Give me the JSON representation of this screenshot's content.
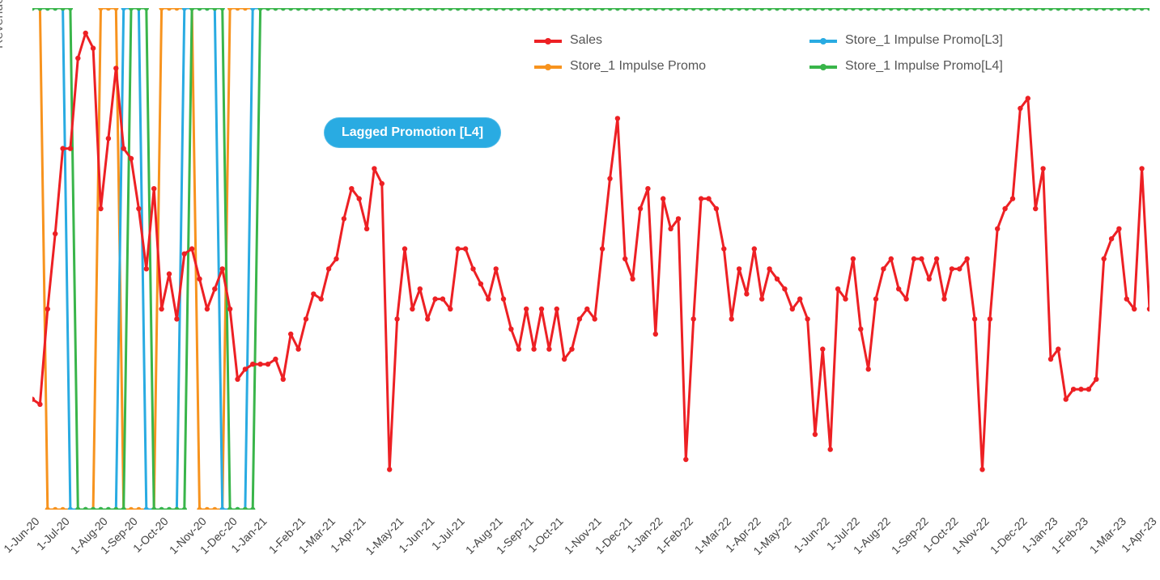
{
  "chart_data": {
    "type": "line",
    "title": "",
    "xlabel": "",
    "ylabel": "Revenue",
    "ylim": [
      0,
      100
    ],
    "colors": {
      "sales": "#ed2024",
      "promo": "#f7931e",
      "promo_l3": "#29abe2",
      "promo_l4": "#39b54a"
    },
    "categories": [
      "1-Jun-20",
      "1-Jul-20",
      "1-Aug-20",
      "1-Sep-20",
      "1-Oct-20",
      "1-Nov-20",
      "1-Dec-20",
      "1-Jan-21",
      "1-Feb-21",
      "1-Mar-21",
      "1-Apr-21",
      "1-May-21",
      "1-Jun-21",
      "1-Jul-21",
      "1-Aug-21",
      "1-Sep-21",
      "1-Oct-21",
      "1-Nov-21",
      "1-Dec-21",
      "1-Jan-22",
      "1-Feb-22",
      "1-Mar-22",
      "1-Apr-22",
      "1-May-22",
      "1-Jun-22",
      "1-Jul-22",
      "1-Aug-22",
      "1-Sep-22",
      "1-Oct-22",
      "1-Nov-22",
      "1-Dec-22",
      "1-Jan-23",
      "1-Feb-23",
      "1-Mar-23",
      "1-Apr-23"
    ],
    "n_weeks": 148,
    "series": [
      {
        "name": "Sales",
        "color_key": "sales",
        "values": [
          22,
          21,
          40,
          55,
          72,
          72,
          90,
          95,
          92,
          60,
          74,
          88,
          72,
          70,
          60,
          48,
          64,
          40,
          47,
          38,
          51,
          52,
          46,
          40,
          44,
          48,
          40,
          26,
          28,
          29,
          29,
          29,
          30,
          26,
          35,
          32,
          38,
          43,
          42,
          48,
          50,
          58,
          64,
          62,
          56,
          68,
          65,
          8,
          38,
          52,
          40,
          44,
          38,
          42,
          42,
          40,
          52,
          52,
          48,
          45,
          42,
          48,
          42,
          36,
          32,
          40,
          32,
          40,
          32,
          40,
          30,
          32,
          38,
          40,
          38,
          52,
          66,
          78,
          50,
          46,
          60,
          64,
          35,
          62,
          56,
          58,
          10,
          38,
          62,
          62,
          60,
          52,
          38,
          48,
          43,
          52,
          42,
          48,
          46,
          44,
          40,
          42,
          38,
          15,
          32,
          12,
          44,
          42,
          50,
          36,
          28,
          42,
          48,
          50,
          44,
          42,
          50,
          50,
          46,
          50,
          42,
          48,
          48,
          50,
          38,
          8,
          38,
          56,
          60,
          62,
          80,
          82,
          60,
          68,
          30,
          32,
          22,
          24,
          24,
          24,
          26,
          50,
          54,
          56,
          42,
          40,
          68,
          40
        ]
      },
      {
        "name": "Store_1 Impulse Promo",
        "color_key": "promo",
        "values": [
          100,
          100,
          0,
          0,
          0,
          0,
          0,
          0,
          0,
          100,
          100,
          100,
          0,
          0,
          0,
          0,
          0,
          100,
          100,
          100,
          100,
          100,
          0,
          0,
          0,
          0,
          100,
          100,
          100,
          100,
          100,
          100,
          100,
          100,
          100,
          100,
          100,
          100,
          100,
          100,
          100,
          100,
          100,
          100,
          100,
          100,
          100,
          100,
          100,
          100,
          100,
          100,
          100,
          100,
          100,
          100,
          100,
          100,
          100,
          100,
          100,
          100,
          100,
          100,
          100,
          100,
          100,
          100,
          100,
          100,
          100,
          100,
          100,
          100,
          100,
          100,
          100,
          100,
          100,
          100,
          100,
          100,
          100,
          100,
          100,
          100,
          100,
          100,
          100,
          100,
          100,
          100,
          100,
          100,
          100,
          100,
          100,
          100,
          100,
          100,
          100,
          100,
          100,
          100,
          100,
          100,
          100,
          100,
          100,
          100,
          100,
          100,
          100,
          100,
          100,
          100,
          100,
          100,
          100,
          100,
          100,
          100,
          100,
          100,
          100,
          100,
          100,
          100,
          100,
          100,
          100,
          100,
          100,
          100,
          100,
          100,
          100,
          100,
          100,
          100,
          100,
          100,
          100,
          100,
          100,
          100,
          100,
          100
        ]
      },
      {
        "name": "Store_1 Impulse Promo[L3]",
        "color_key": "promo_l3",
        "values": [
          100,
          100,
          100,
          100,
          100,
          0,
          0,
          0,
          0,
          0,
          0,
          0,
          100,
          100,
          100,
          0,
          0,
          0,
          0,
          0,
          100,
          100,
          100,
          100,
          100,
          0,
          0,
          0,
          0,
          100,
          100,
          100,
          100,
          100,
          100,
          100,
          100,
          100,
          100,
          100,
          100,
          100,
          100,
          100,
          100,
          100,
          100,
          100,
          100,
          100,
          100,
          100,
          100,
          100,
          100,
          100,
          100,
          100,
          100,
          100,
          100,
          100,
          100,
          100,
          100,
          100,
          100,
          100,
          100,
          100,
          100,
          100,
          100,
          100,
          100,
          100,
          100,
          100,
          100,
          100,
          100,
          100,
          100,
          100,
          100,
          100,
          100,
          100,
          100,
          100,
          100,
          100,
          100,
          100,
          100,
          100,
          100,
          100,
          100,
          100,
          100,
          100,
          100,
          100,
          100,
          100,
          100,
          100,
          100,
          100,
          100,
          100,
          100,
          100,
          100,
          100,
          100,
          100,
          100,
          100,
          100,
          100,
          100,
          100,
          100,
          100,
          100,
          100,
          100,
          100,
          100,
          100,
          100,
          100,
          100,
          100,
          100,
          100,
          100,
          100,
          100,
          100,
          100,
          100,
          100,
          100,
          100,
          100
        ]
      },
      {
        "name": "Store_1 Impulse Promo[L4]",
        "color_key": "promo_l4",
        "values": [
          100,
          100,
          100,
          100,
          100,
          100,
          0,
          0,
          0,
          0,
          0,
          0,
          0,
          100,
          100,
          100,
          0,
          0,
          0,
          0,
          0,
          100,
          100,
          100,
          100,
          100,
          0,
          0,
          0,
          0,
          100,
          100,
          100,
          100,
          100,
          100,
          100,
          100,
          100,
          100,
          100,
          100,
          100,
          100,
          100,
          100,
          100,
          100,
          100,
          100,
          100,
          100,
          100,
          100,
          100,
          100,
          100,
          100,
          100,
          100,
          100,
          100,
          100,
          100,
          100,
          100,
          100,
          100,
          100,
          100,
          100,
          100,
          100,
          100,
          100,
          100,
          100,
          100,
          100,
          100,
          100,
          100,
          100,
          100,
          100,
          100,
          100,
          100,
          100,
          100,
          100,
          100,
          100,
          100,
          100,
          100,
          100,
          100,
          100,
          100,
          100,
          100,
          100,
          100,
          100,
          100,
          100,
          100,
          100,
          100,
          100,
          100,
          100,
          100,
          100,
          100,
          100,
          100,
          100,
          100,
          100,
          100,
          100,
          100,
          100,
          100,
          100,
          100,
          100,
          100,
          100,
          100,
          100,
          100,
          100,
          100,
          100,
          100,
          100,
          100,
          100,
          100,
          100,
          100,
          100,
          100,
          100,
          100
        ]
      }
    ],
    "legend": {
      "position": "top-center",
      "items": [
        "Sales",
        "Store_1 Impulse Promo[L3]",
        "Store_1 Impulse Promo",
        "Store_1 Impulse Promo[L4]"
      ]
    },
    "annotation": {
      "text": "Lagged Promotion [L4]"
    }
  }
}
